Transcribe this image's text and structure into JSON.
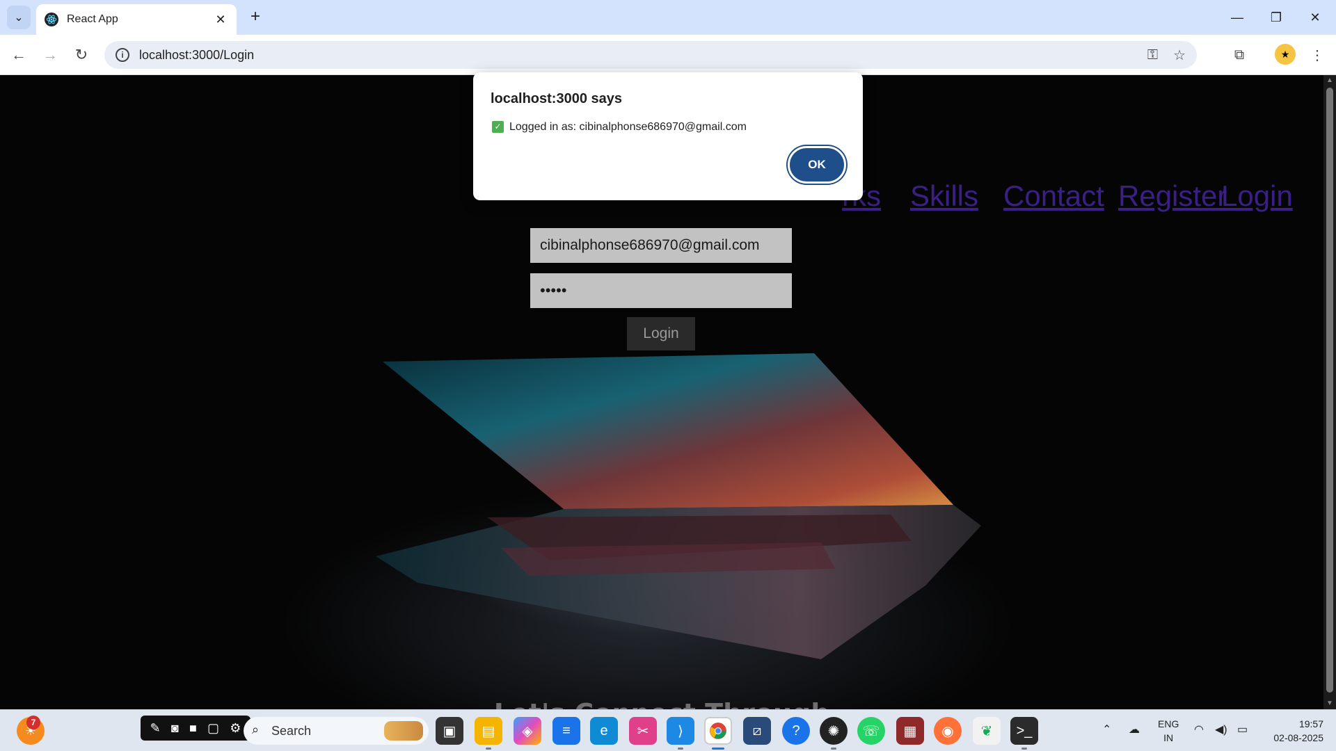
{
  "browser": {
    "tab_title": "React App",
    "url": "localhost:3000/Login",
    "window_controls": [
      "minimize",
      "restore",
      "close"
    ]
  },
  "nav": {
    "links": [
      "rks",
      "Skills",
      "Contact",
      "Register",
      "Login"
    ]
  },
  "login_form": {
    "email_value": "cibinalphonse686970@gmail.com",
    "password_mask": "•••••",
    "login_label": "Login"
  },
  "connect": {
    "heading": "Let's Connect Through"
  },
  "dialog": {
    "title": "localhost:3000 says",
    "check_icon": "✓",
    "message": "Logged in as: cibinalphonse686970@gmail.com",
    "ok_label": "OK"
  },
  "taskbar": {
    "notification_count": "7",
    "search_label": "Search",
    "lang_line1": "ENG",
    "lang_line2": "IN",
    "time": "19:57",
    "date": "02-08-2025"
  },
  "colors": {
    "nav_link": "#3a1f86",
    "dialog_ok": "#1f4f8a",
    "tabbar": "#d3e3fd"
  }
}
